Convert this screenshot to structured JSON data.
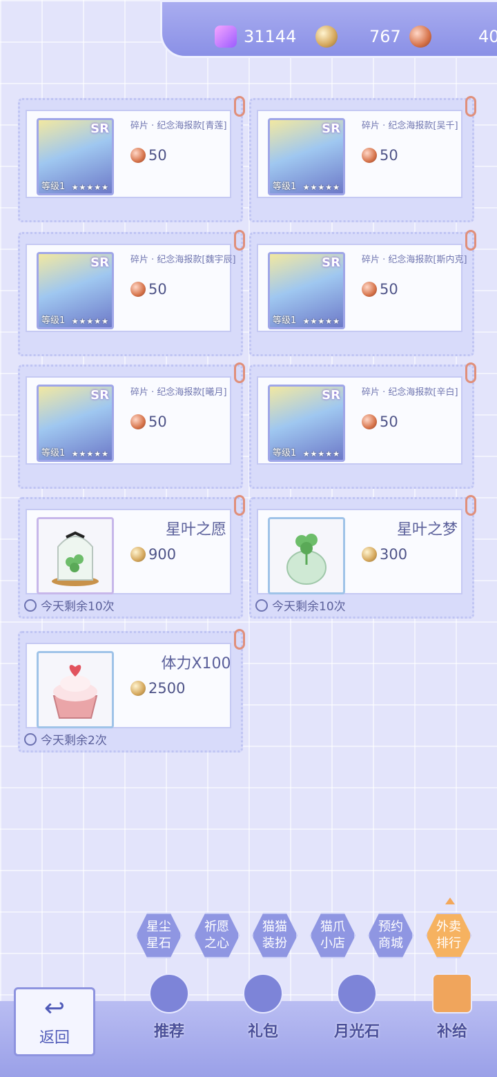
{
  "currency": {
    "swan": "31144",
    "coin": "767",
    "moonstone": "40"
  },
  "cards": [
    {
      "name": "碎片 · 纪念海报款[青莲]",
      "price": "50",
      "level": "等级1",
      "stars": "★★★★★",
      "badge": "SR"
    },
    {
      "name": "碎片 · 纪念海报款[吴千]",
      "price": "50",
      "level": "等级1",
      "stars": "★★★★★",
      "badge": "SR"
    },
    {
      "name": "碎片 · 纪念海报款[魏宇辰]",
      "price": "50",
      "level": "等级1",
      "stars": "★★★★★",
      "badge": "SR"
    },
    {
      "name": "碎片 · 纪念海报款[斯内克]",
      "price": "50",
      "level": "等级1",
      "stars": "★★★★★",
      "badge": "SR"
    },
    {
      "name": "碎片 · 纪念海报款[曦月]",
      "price": "50",
      "level": "等级1",
      "stars": "★★★★★",
      "badge": "SR"
    },
    {
      "name": "碎片 · 纪念海报款[辛白]",
      "price": "50",
      "level": "等级1",
      "stars": "★★★★★",
      "badge": "SR"
    }
  ],
  "items": [
    {
      "name": "星叶之愿",
      "price": "900",
      "remain": "今天剩余10次"
    },
    {
      "name": "星叶之梦",
      "price": "300",
      "remain": "今天剩余10次"
    },
    {
      "name": "体力X100",
      "price": "2500",
      "remain": "今天剩余2次"
    }
  ],
  "categories": [
    {
      "label": "星尘星石"
    },
    {
      "label": "祈愿之心"
    },
    {
      "label": "猫猫装扮"
    },
    {
      "label": "猫爪小店"
    },
    {
      "label": "预约商城"
    },
    {
      "label": "外卖排行"
    }
  ],
  "nav": {
    "back": "返回",
    "tabs": [
      "推荐",
      "礼包",
      "月光石",
      "补给"
    ]
  },
  "colors": {
    "accent": "#8f96e2",
    "active": "#f6b260"
  }
}
